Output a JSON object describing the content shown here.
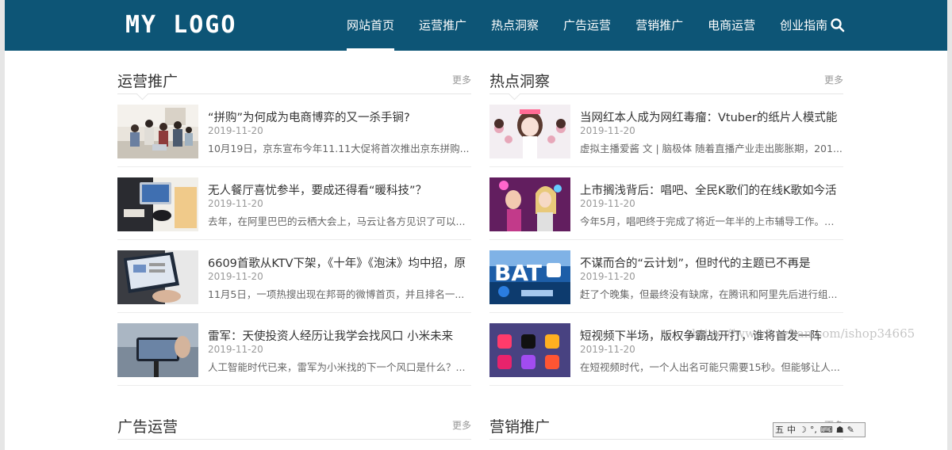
{
  "header": {
    "logo_text": "MY LOGO",
    "nav": [
      {
        "label": "网站首页",
        "active": true
      },
      {
        "label": "运营推广"
      },
      {
        "label": "热点洞察"
      },
      {
        "label": "广告运营"
      },
      {
        "label": "营销推广"
      },
      {
        "label": "电商运营"
      },
      {
        "label": "创业指南"
      }
    ],
    "search_icon": "search-icon"
  },
  "sections": [
    {
      "title": "运营推广",
      "more": "更多",
      "articles": [
        {
          "title": "“拼购”为何成为电商博弈的又一杀手锏?",
          "date": "2019-11-20",
          "excerpt": "10月19日，京东宣布今年11.11大促将首次推出京东拼购..."
        },
        {
          "title": "无人餐厅喜忧参半，要成还得看“暖科技”？",
          "date": "2019-11-20",
          "excerpt": "去年，在阿里巴巴的云栖大会上，马云让各方见识了可以..."
        },
        {
          "title": "6609首歌从KTV下架，《十年》《泡沫》均中招，原",
          "date": "2019-11-20",
          "excerpt": "11月5日，一项热搜出现在邦哥的微博首页，并且排名一..."
        },
        {
          "title": "雷军：天使投资人经历让我学会找风口 小米未来",
          "date": "2019-11-20",
          "excerpt": "人工智能时代已来，雷军为小米找的下一个风口是什么？..."
        }
      ]
    },
    {
      "title": "热点洞察",
      "more": "更多",
      "articles": [
        {
          "title": "当网红本人成为网红毒瘤：Vtuber的纸片人模式能",
          "date": "2019-11-20",
          "excerpt": "虚拟主播爱酱 文 | 脑极体 随着直播产业走出膨胀期，201..."
        },
        {
          "title": "上市搁浅背后：唱吧、全民K歌们的在线K歌如今活",
          "date": "2019-11-20",
          "excerpt": "今年5月，唱吧终于完成了将近一年半的上市辅导工作。网..."
        },
        {
          "title": "不谋而合的“云计划”，但时代的主题已不再是",
          "date": "2019-11-20",
          "excerpt": "赶了个晚集，但最终没有缺席，在腾讯和阿里先后进行组..."
        },
        {
          "title": "短视频下半场，版权争霸战开打，谁将首发一阵",
          "date": "2019-11-20",
          "excerpt": "在短视频时代，一个人出名可能只需要15秒。但能够让人..."
        }
      ]
    },
    {
      "title": "广告运营",
      "more": "更多"
    },
    {
      "title": "营销推广",
      "more": "更多"
    }
  ],
  "watermark": "https://www.huzhan.com/ishop34665",
  "ime": {
    "items": [
      "五",
      "中",
      "☽",
      "°,",
      "⌨",
      "☗",
      "✎"
    ]
  }
}
